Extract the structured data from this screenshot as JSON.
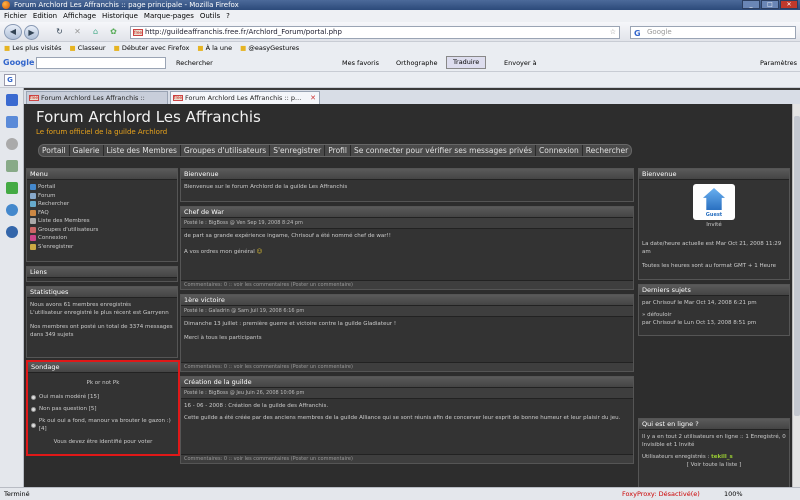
{
  "window": {
    "title": "Forum Archlord Les Affranchis :: page principale - Mozilla Firefox"
  },
  "menubar": [
    "Fichier",
    "Edition",
    "Affichage",
    "Historique",
    "Marque-pages",
    "Outils",
    "?"
  ],
  "navbar": {
    "url": "http://guildeaffranchis.free.fr/Archlord_Forum/portal.php",
    "search_placeholder": "Google",
    "search_engine_letter": "G",
    "favicon_text": "free"
  },
  "bookmarks": [
    "Les plus visités",
    "Classeur",
    "Débuter avec Firefox",
    "À la une",
    "@easyGestures"
  ],
  "googlebar": {
    "logo": "Google",
    "search": "Rechercher",
    "favs": "Mes favoris",
    "spell": "Orthographe",
    "translate": "Traduire",
    "send": "Envoyer à",
    "settings": "Paramètres"
  },
  "addonbar": {
    "icon": "G"
  },
  "tabs": [
    {
      "label": "Forum Archlord Les Affranchis ::"
    },
    {
      "label": "Forum Archlord Les Affranchis :: p..."
    }
  ],
  "forum": {
    "title": "Forum Archlord Les Affranchis",
    "subtitle": "Le forum officiel de la guilde Archlord",
    "nav": [
      "Portail",
      "Galerie",
      "Liste des Membres",
      "Groupes d'utilisateurs",
      "S'enregistrer",
      "Profil",
      "Se connecter pour vérifier ses messages privés",
      "Connexion",
      "Rechercher"
    ]
  },
  "left": {
    "menu_title": "Menu",
    "menu_items": [
      "Portail",
      "Forum",
      "Rechercher",
      "FAQ",
      "Liste des Membres",
      "Groupes d'utilisateurs",
      "Connexion",
      "S'enregistrer"
    ],
    "links_title": "Liens",
    "stats_title": "Statistiques",
    "stats_1": "Nous avons 61 membres enregistrés",
    "stats_2": "L'utilisateur enregistré le plus récent est Garryenn",
    "stats_3": "Nos membres ont posté un total de 3374 messages dans 349 sujets",
    "poll_title": "Sondage",
    "poll_question": "Pk or not Pk",
    "poll_options": [
      "Oui mais modéré [15]",
      "Non pas question [5]",
      "Pk oui oui a fond, manour va brouter le gazon :) [4]"
    ],
    "poll_note": "Vous devez être identifié pour voter"
  },
  "center": {
    "welcome_title": "Bienvenue",
    "welcome_text": "Bienvenue sur le forum Archlord de la guilde Les Affranchis",
    "posts": [
      {
        "title": "Chef de War",
        "meta": "Posté le : BigBoss @ Ven Sep 19, 2008 8:24 pm",
        "body": "de part sa grande expérience ingame, Chrisouf a été nommé chef de war!!",
        "body2": "A vos ordres mon général",
        "foot": "Commentaires: 0 :: voir les commentaires (Poster un commentaire)"
      },
      {
        "title": "1ère victoire",
        "meta": "Posté le : Galadrin @ Sam Juil 19, 2008 6:16 pm",
        "body": "Dimanche 13 juillet : première guerre et victoire contre la guilde Gladiateur !",
        "body2": "Merci à tous les participants",
        "foot": "Commentaires: 0 :: voir les commentaires (Poster un commentaire)"
      },
      {
        "title": "Création de la guilde",
        "meta": "Posté le : BigBoss @ Jeu Juin 26, 2008 10:06 pm",
        "body": "16 - 06 - 2008 : Création de la guilde des Affranchis.",
        "body2": "Cette guilde a été créée par des anciens membres de la guilde Alliance qui se sont réunis afin de concerver leur esprit de bonne humeur et leur plaisir du jeu.",
        "foot": "Commentaires: 0 :: voir les commentaires (Poster un commentaire)"
      }
    ]
  },
  "right": {
    "welcome_title": "Bienvenue",
    "guest_label": "Guest",
    "guest_caption": "Invité",
    "date_text": "La date/heure actuelle est Mar Oct 21, 2008 11:29 am",
    "tz_text": "Toutes les heures sont au format GMT + 1 Heure",
    "last_title": "Derniers sujets",
    "last_1": "par Chrisouf le Mar Oct 14, 2008 6:21 pm",
    "last_2": "» défouloir",
    "last_3": "par Chrisouf le Lun Oct 13, 2008 8:51 pm",
    "online_title": "Qui est en ligne ?",
    "online_1": "Il y a en tout 2 utilisateurs en ligne :: 1 Enregistré, 0 Invisible et 1 Invité",
    "online_2": "Utilisateurs enregistrés :",
    "online_user": "tekill_s",
    "online_3": "[ Voir toute la liste ]"
  },
  "status": {
    "left": "Terminé",
    "foxy": "FoxyProxy: Désactivé(e)",
    "zoom": "100%"
  }
}
